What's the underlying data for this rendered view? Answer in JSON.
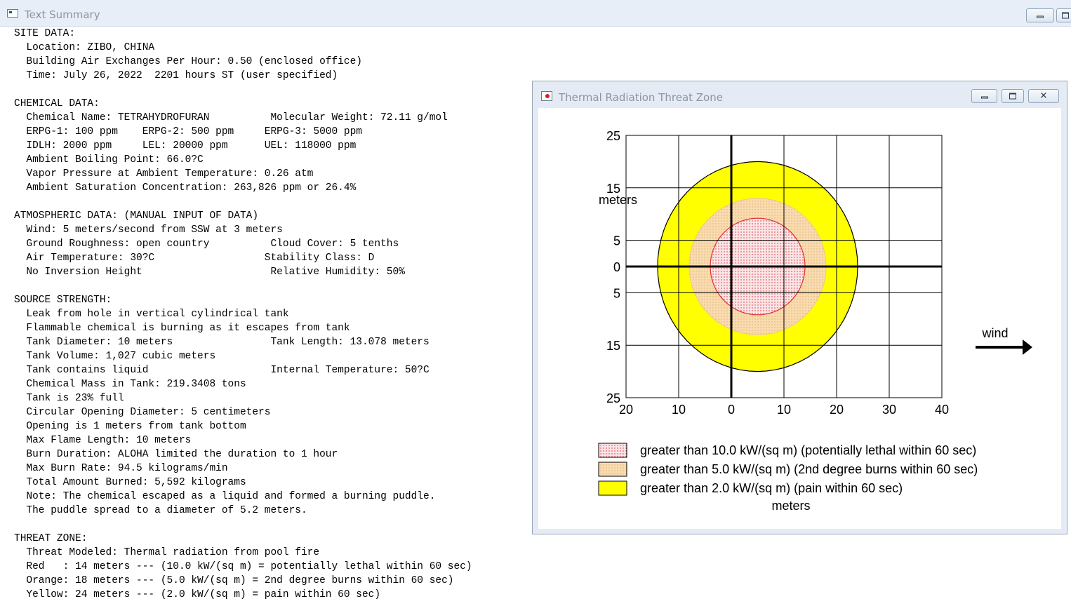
{
  "window": {
    "title": "Text Summary"
  },
  "summary_lines": [
    "SITE DATA:",
    "  Location: ZIBO, CHINA",
    "  Building Air Exchanges Per Hour: 0.50 (enclosed office)",
    "  Time: July 26, 2022  2201 hours ST (user specified)",
    "",
    "CHEMICAL DATA:",
    "  Chemical Name: TETRAHYDROFURAN          Molecular Weight: 72.11 g/mol",
    "  ERPG-1: 100 ppm    ERPG-2: 500 ppm     ERPG-3: 5000 ppm",
    "  IDLH: 2000 ppm     LEL: 20000 ppm      UEL: 118000 ppm",
    "  Ambient Boiling Point: 66.0?C",
    "  Vapor Pressure at Ambient Temperature: 0.26 atm",
    "  Ambient Saturation Concentration: 263,826 ppm or 26.4%",
    "",
    "ATMOSPHERIC DATA: (MANUAL INPUT OF DATA)",
    "  Wind: 5 meters/second from SSW at 3 meters",
    "  Ground Roughness: open country          Cloud Cover: 5 tenths",
    "  Air Temperature: 30?C                  Stability Class: D",
    "  No Inversion Height                     Relative Humidity: 50%",
    "",
    "SOURCE STRENGTH:",
    "  Leak from hole in vertical cylindrical tank",
    "  Flammable chemical is burning as it escapes from tank",
    "  Tank Diameter: 10 meters                Tank Length: 13.078 meters",
    "  Tank Volume: 1,027 cubic meters",
    "  Tank contains liquid                    Internal Temperature: 50?C",
    "  Chemical Mass in Tank: 219.3408 tons",
    "  Tank is 23% full",
    "  Circular Opening Diameter: 5 centimeters",
    "  Opening is 1 meters from tank bottom",
    "  Max Flame Length: 10 meters",
    "  Burn Duration: ALOHA limited the duration to 1 hour",
    "  Max Burn Rate: 94.5 kilograms/min",
    "  Total Amount Burned: 5,592 kilograms",
    "  Note: The chemical escaped as a liquid and formed a burning puddle.",
    "  The puddle spread to a diameter of 5.2 meters.",
    "",
    "THREAT ZONE:",
    "  Threat Modeled: Thermal radiation from pool fire",
    "  Red   : 14 meters --- (10.0 kW/(sq m) = potentially lethal within 60 sec)",
    "  Orange: 18 meters --- (5.0 kW/(sq m) = 2nd degree burns within 60 sec)",
    "  Yellow: 24 meters --- (2.0 kW/(sq m) = pain within 60 sec)"
  ],
  "threat_window": {
    "title": "Thermal Radiation Threat Zone"
  },
  "chart_data": {
    "type": "area",
    "ylabel": "meters",
    "xlabel": "meters",
    "xlim": [
      -20,
      40
    ],
    "ylim": [
      -25,
      25
    ],
    "x_ticks": [
      -20,
      -10,
      0,
      10,
      20,
      30,
      40
    ],
    "x_tick_labels": [
      "20",
      "10",
      "0",
      "10",
      "20",
      "30",
      "40"
    ],
    "y_ticks": [
      25,
      15,
      5,
      0,
      -5,
      -15,
      -25
    ],
    "y_tick_labels": [
      "25",
      "15",
      "5",
      "0",
      "5",
      "15",
      "25"
    ],
    "grid": true,
    "wind_label": "wind",
    "zones": [
      {
        "name": "yellow",
        "color": "#ffff00",
        "center_x": 5,
        "reach_x": 24,
        "half_width": 20,
        "legend": "greater than 2.0 kW/(sq m) (pain within 60 sec)"
      },
      {
        "name": "orange",
        "color": "#f8dcb0",
        "center_x": 5,
        "reach_x": 18,
        "half_width": 13,
        "legend": "greater than 5.0 kW/(sq m) (2nd degree burns within 60 sec)"
      },
      {
        "name": "red",
        "color": "#fbe3e6",
        "center_x": 5,
        "reach_x": 14,
        "half_width": 9.2,
        "legend": "greater than 10.0 kW/(sq m) (potentially lethal within 60 sec)"
      }
    ],
    "legend_order": [
      "red",
      "orange",
      "yellow"
    ]
  }
}
